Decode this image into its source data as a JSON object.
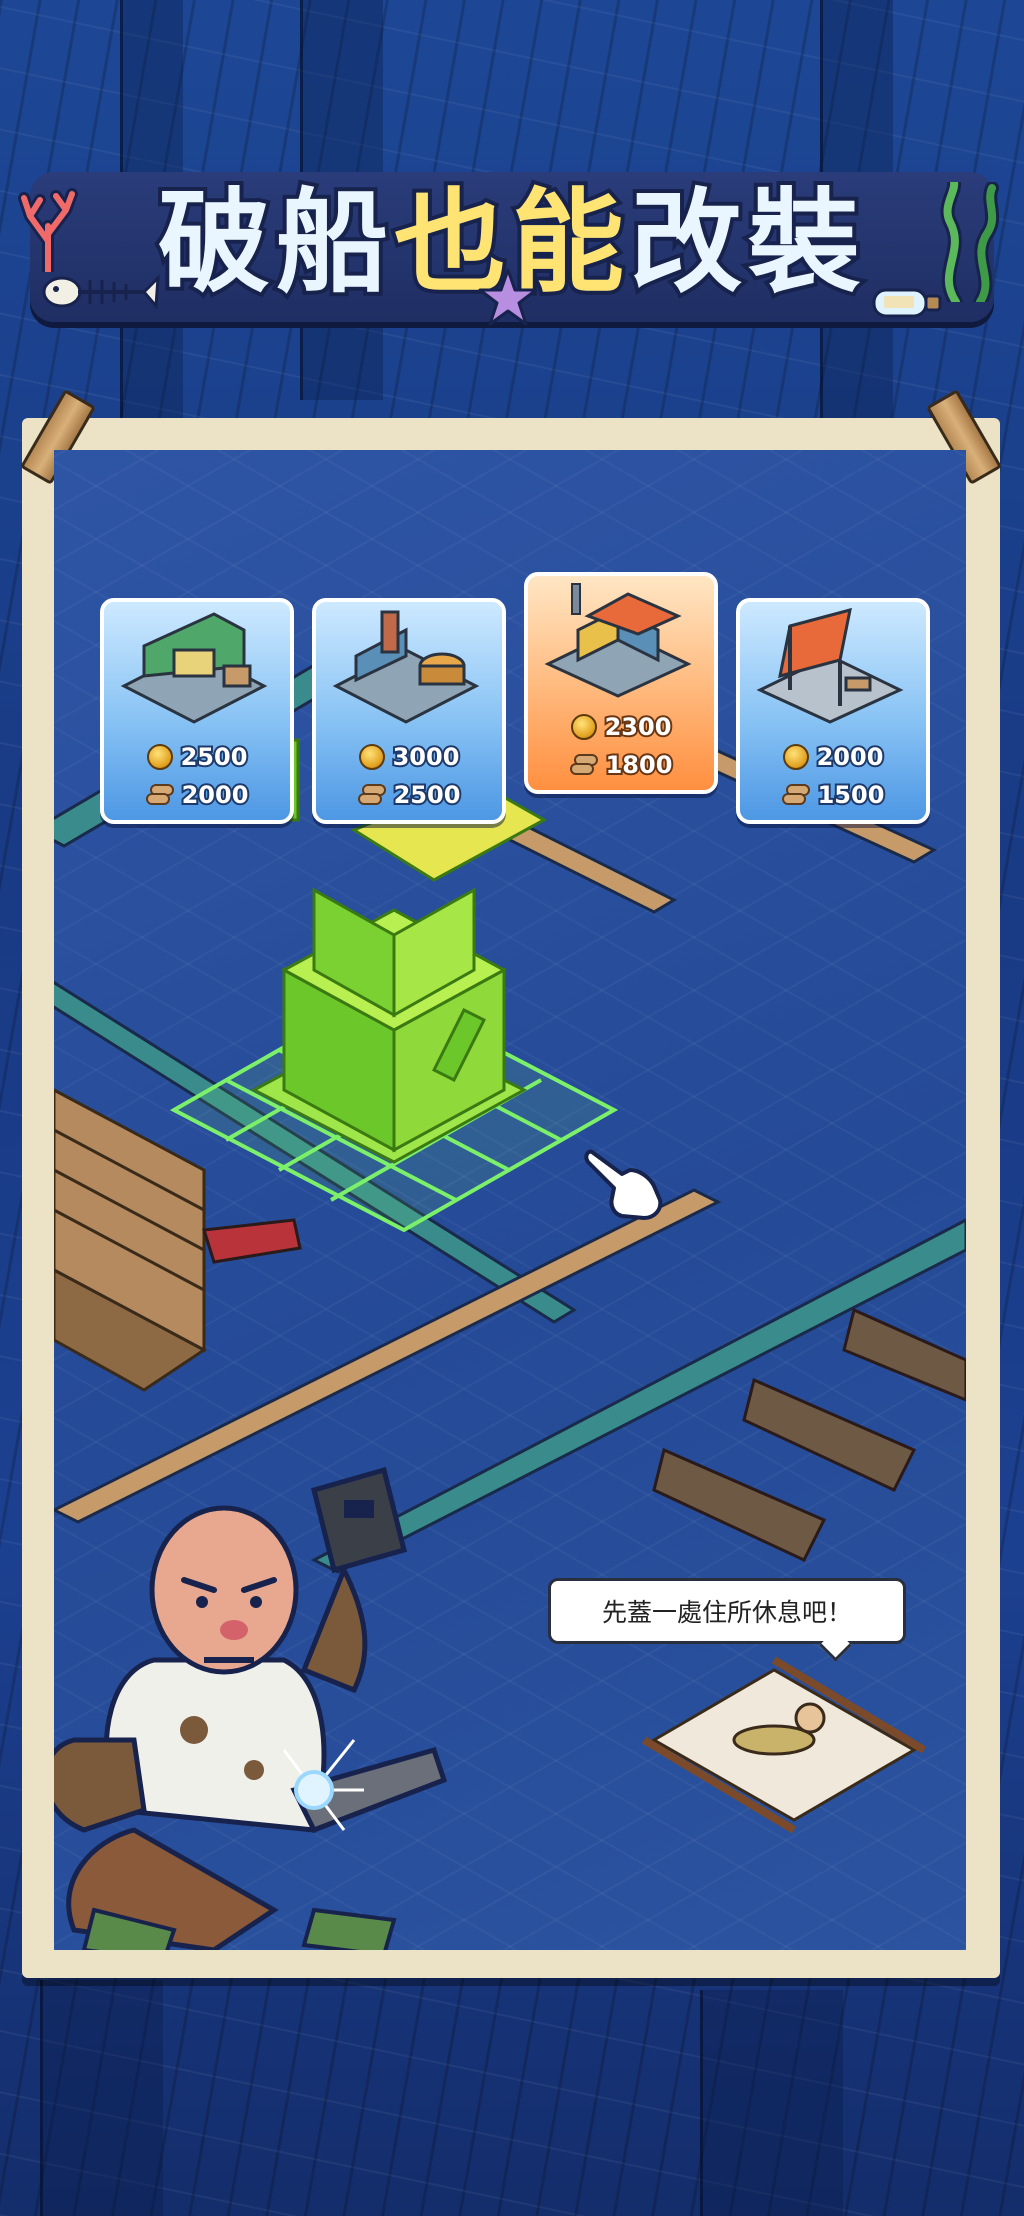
{
  "title": {
    "part1": "破船",
    "part2": "也能",
    "part3": "改裝"
  },
  "cards": [
    {
      "id": "shop",
      "coins": "2500",
      "wood": "2000",
      "selected": false
    },
    {
      "id": "kitchen",
      "coins": "3000",
      "wood": "2500",
      "selected": false
    },
    {
      "id": "house",
      "coins": "2300",
      "wood": "1800",
      "selected": true
    },
    {
      "id": "workshop",
      "coins": "2000",
      "wood": "1500",
      "selected": false
    }
  ],
  "icons": {
    "coin": "coin-icon",
    "wood": "wood-log-icon",
    "pointer": "pointing-hand-icon"
  },
  "hint_bubble": "先蓋一處住所休息吧！",
  "colors": {
    "card_blue": "#87c2f4",
    "card_orange": "#ffb77a",
    "ghost_green": "#7df06a",
    "title_yellow": "#ffe474"
  }
}
